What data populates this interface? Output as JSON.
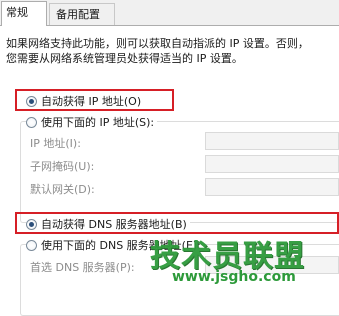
{
  "tabs": [
    {
      "label": "常规"
    },
    {
      "label": "备用配置"
    }
  ],
  "description": {
    "line1": "如果网络支持此功能，则可以获取自动指派的 IP 设置。否则，",
    "line2": "您需要从网络系统管理员处获得适当的 IP 设置。"
  },
  "ip": {
    "auto_label": "自动获得 IP 地址(O)",
    "manual_label": "使用下面的 IP 地址(S):",
    "fields": [
      {
        "label": "IP 地址(I):",
        "value": ""
      },
      {
        "label": "子网掩码(U):",
        "value": ""
      },
      {
        "label": "默认网关(D):",
        "value": ""
      }
    ]
  },
  "dns": {
    "auto_label": "自动获得 DNS 服务器地址(B)",
    "manual_label": "使用下面的 DNS 服务器地址(E):",
    "fields": [
      {
        "label": "首选 DNS 服务器(P):",
        "value": ""
      }
    ]
  },
  "watermark": {
    "text": "技术员联盟",
    "url": "www.jsgho.com"
  },
  "colors": {
    "highlight_box": "#d61f26",
    "watermark": "#2d9a3a"
  }
}
